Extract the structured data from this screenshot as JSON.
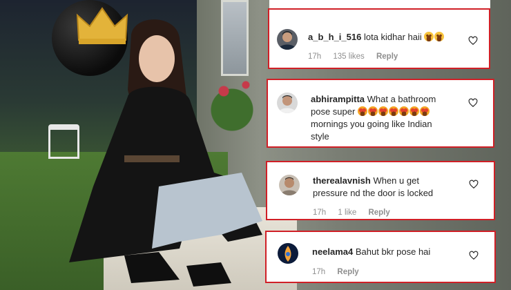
{
  "comments": [
    {
      "username": "a_b_h_i_516",
      "text": "lota kidhar haii",
      "emoji_count": 2,
      "emoji_type": "grin",
      "time": "17h",
      "likes": "135 likes",
      "reply": "Reply"
    },
    {
      "username": "abhirampitta",
      "text_line1": "What a bathroom",
      "text_line2_prefix": "pose super",
      "emoji_count": 7,
      "emoji_type": "star-struck",
      "text_line3": "mornings you going like Indian",
      "text_line4": "style"
    },
    {
      "username": "therealavnish",
      "text_line1": "When u get",
      "text_line2": "pressure nd the door is locked",
      "time": "17h",
      "likes": "1 like",
      "reply": "Reply"
    },
    {
      "username": "neelama4",
      "text": "Bahut bkr pose hai",
      "time": "17h",
      "reply": "Reply"
    }
  ],
  "colors": {
    "card_border": "#d01f26",
    "text": "#262626",
    "meta": "#8e8e8e"
  },
  "icons": [
    "heart-outline-icon",
    "avatar"
  ]
}
